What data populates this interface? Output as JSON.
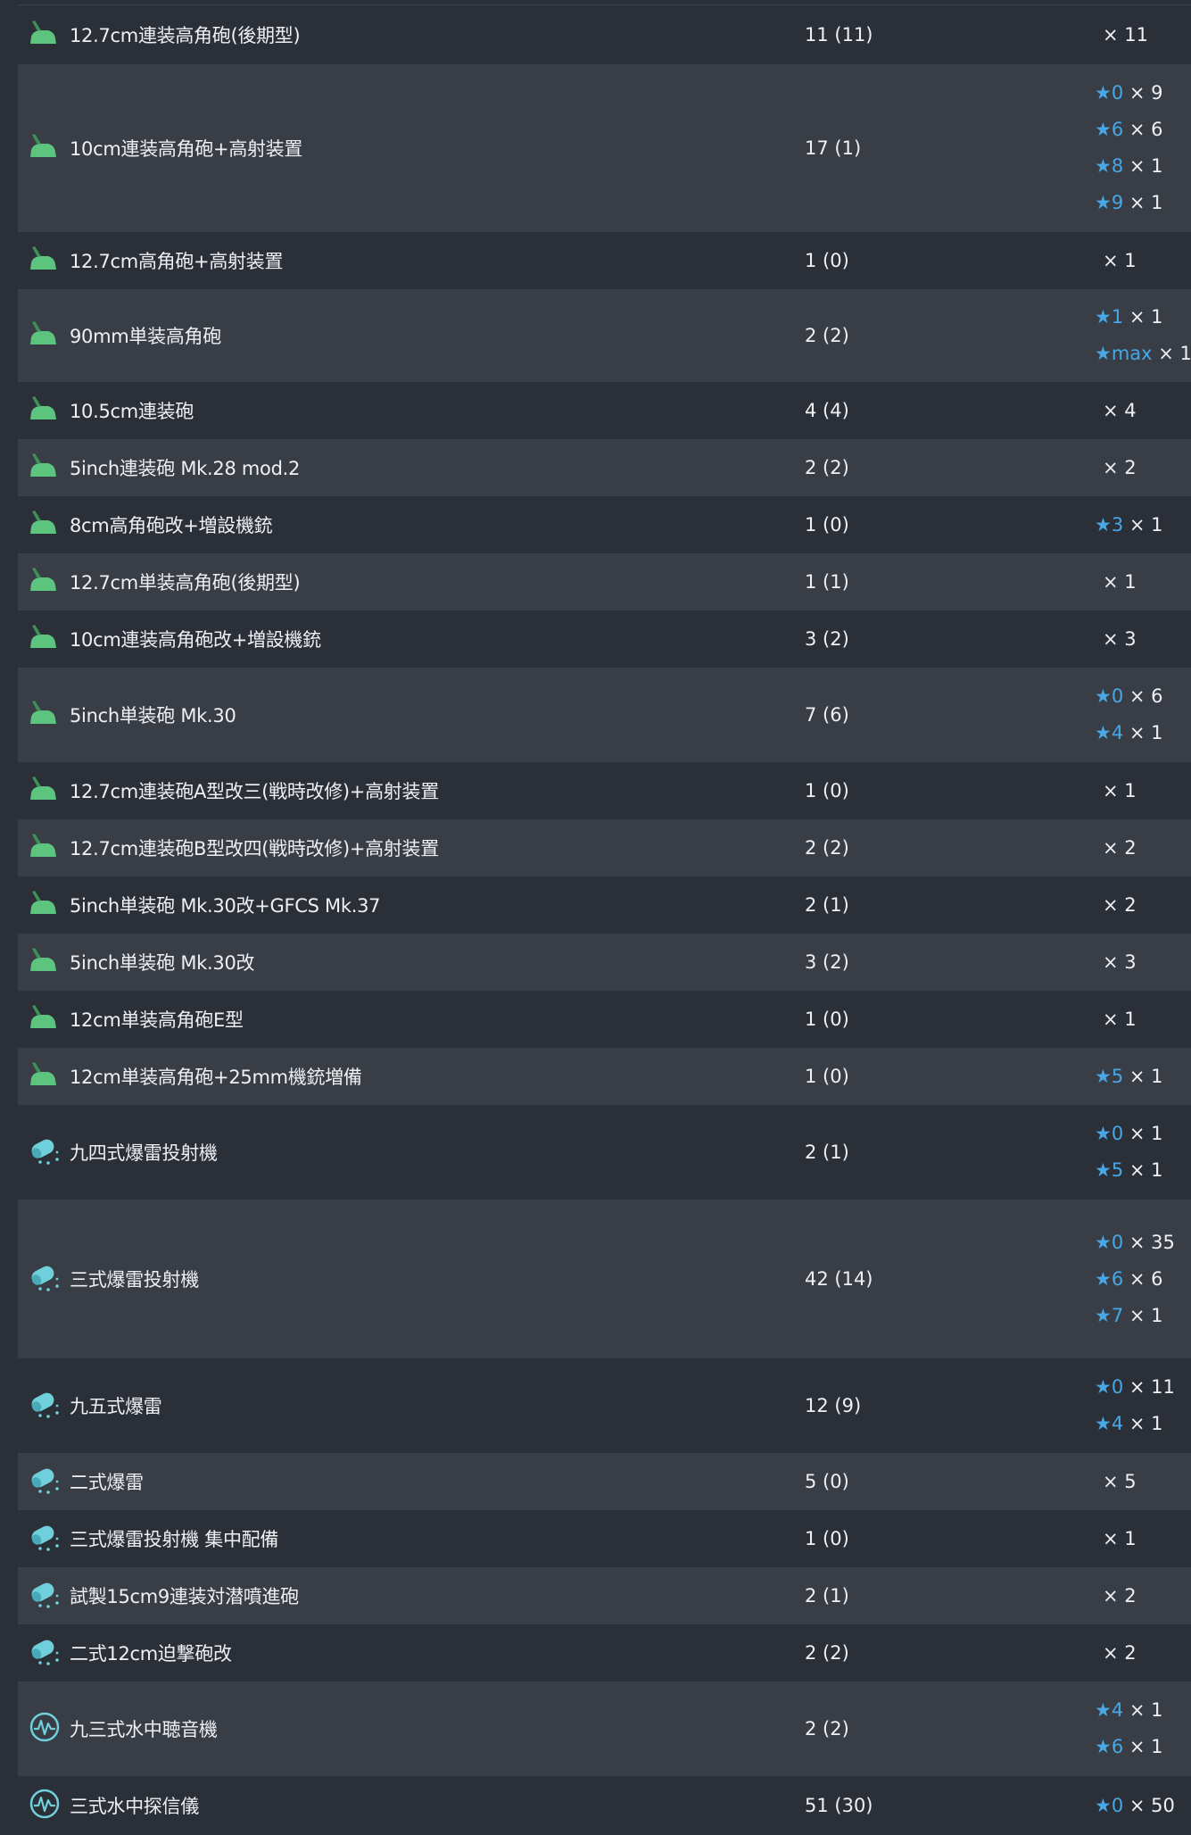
{
  "colors": {
    "background": "#2b2f38",
    "row_alt": "#393d46",
    "text": "#eef0f2",
    "star": "#46a8e6",
    "gun_icon": "#5cc47e",
    "asw_icon": "#6fd0dc"
  },
  "rows": [
    {
      "name": "12.7cm連装高角砲(後期型)",
      "icon": "aa-gun-icon",
      "count": "11 (11)",
      "stars": [
        {
          "level": null,
          "count": "× 11"
        }
      ]
    },
    {
      "name": "10cm連装高角砲+高射装置",
      "icon": "aa-gun-icon",
      "count": "17 (1)",
      "stars": [
        {
          "level": "0",
          "count": "× 9"
        },
        {
          "level": "6",
          "count": "× 6"
        },
        {
          "level": "8",
          "count": "× 1"
        },
        {
          "level": "9",
          "count": "× 1"
        }
      ]
    },
    {
      "name": "12.7cm高角砲+高射装置",
      "icon": "aa-gun-icon",
      "count": "1 (0)",
      "stars": [
        {
          "level": null,
          "count": "× 1"
        }
      ]
    },
    {
      "name": "90mm単装高角砲",
      "icon": "aa-gun-icon",
      "count": "2 (2)",
      "stars": [
        {
          "level": "1",
          "count": "× 1"
        },
        {
          "level": "max",
          "count": "× 1"
        }
      ]
    },
    {
      "name": "10.5cm連装砲",
      "icon": "aa-gun-icon",
      "count": "4 (4)",
      "stars": [
        {
          "level": null,
          "count": "× 4"
        }
      ]
    },
    {
      "name": "5inch連装砲 Mk.28 mod.2",
      "icon": "aa-gun-icon",
      "count": "2 (2)",
      "stars": [
        {
          "level": null,
          "count": "× 2"
        }
      ]
    },
    {
      "name": "8cm高角砲改+増設機銃",
      "icon": "aa-gun-icon",
      "count": "1 (0)",
      "stars": [
        {
          "level": "3",
          "count": "× 1"
        }
      ]
    },
    {
      "name": "12.7cm単装高角砲(後期型)",
      "icon": "aa-gun-icon",
      "count": "1 (1)",
      "stars": [
        {
          "level": null,
          "count": "× 1"
        }
      ]
    },
    {
      "name": "10cm連装高角砲改+増設機銃",
      "icon": "aa-gun-icon",
      "count": "3 (2)",
      "stars": [
        {
          "level": null,
          "count": "× 3"
        }
      ]
    },
    {
      "name": "5inch単装砲 Mk.30",
      "icon": "aa-gun-icon",
      "count": "7 (6)",
      "stars": [
        {
          "level": "0",
          "count": "× 6"
        },
        {
          "level": "4",
          "count": "× 1"
        }
      ]
    },
    {
      "name": "12.7cm連装砲A型改三(戦時改修)+高射装置",
      "icon": "aa-gun-icon",
      "count": "1 (0)",
      "stars": [
        {
          "level": null,
          "count": "× 1"
        }
      ]
    },
    {
      "name": "12.7cm連装砲B型改四(戦時改修)+高射装置",
      "icon": "aa-gun-icon",
      "count": "2 (2)",
      "stars": [
        {
          "level": null,
          "count": "× 2"
        }
      ]
    },
    {
      "name": "5inch単装砲 Mk.30改+GFCS Mk.37",
      "icon": "aa-gun-icon",
      "count": "2 (1)",
      "stars": [
        {
          "level": null,
          "count": "× 2"
        }
      ]
    },
    {
      "name": "5inch単装砲 Mk.30改",
      "icon": "aa-gun-icon",
      "count": "3 (2)",
      "stars": [
        {
          "level": null,
          "count": "× 3"
        }
      ]
    },
    {
      "name": "12cm単装高角砲E型",
      "icon": "aa-gun-icon",
      "count": "1 (0)",
      "stars": [
        {
          "level": null,
          "count": "× 1"
        }
      ]
    },
    {
      "name": "12cm単装高角砲+25mm機銃増備",
      "icon": "aa-gun-icon",
      "count": "1 (0)",
      "stars": [
        {
          "level": "5",
          "count": "× 1"
        }
      ]
    },
    {
      "name": "九四式爆雷投射機",
      "icon": "depth-charge-icon",
      "count": "2 (1)",
      "stars": [
        {
          "level": "0",
          "count": "× 1"
        },
        {
          "level": "5",
          "count": "× 1"
        }
      ]
    },
    {
      "name": "三式爆雷投射機",
      "icon": "depth-charge-icon",
      "count": "42 (14)",
      "stars": [
        {
          "level": "0",
          "count": "× 35"
        },
        {
          "level": "6",
          "count": "× 6"
        },
        {
          "level": "7",
          "count": "× 1"
        }
      ]
    },
    {
      "name": "九五式爆雷",
      "icon": "depth-charge-icon",
      "count": "12 (9)",
      "stars": [
        {
          "level": "0",
          "count": "× 11"
        },
        {
          "level": "4",
          "count": "× 1"
        }
      ]
    },
    {
      "name": "二式爆雷",
      "icon": "depth-charge-icon",
      "count": "5 (0)",
      "stars": [
        {
          "level": null,
          "count": "× 5"
        }
      ]
    },
    {
      "name": "三式爆雷投射機 集中配備",
      "icon": "depth-charge-icon",
      "count": "1 (0)",
      "stars": [
        {
          "level": null,
          "count": "× 1"
        }
      ]
    },
    {
      "name": "試製15cm9連装対潜噴進砲",
      "icon": "depth-charge-icon",
      "count": "2 (1)",
      "stars": [
        {
          "level": null,
          "count": "× 2"
        }
      ]
    },
    {
      "name": "二式12cm迫撃砲改",
      "icon": "depth-charge-icon",
      "count": "2 (2)",
      "stars": [
        {
          "level": null,
          "count": "× 2"
        }
      ]
    },
    {
      "name": "九三式水中聴音機",
      "icon": "sonar-icon",
      "count": "2 (2)",
      "stars": [
        {
          "level": "4",
          "count": "× 1"
        },
        {
          "level": "6",
          "count": "× 1"
        }
      ]
    },
    {
      "name": "三式水中探信儀",
      "icon": "sonar-icon",
      "count": "51 (30)",
      "stars": [
        {
          "level": "0",
          "count": "× 50"
        },
        {
          "level": null,
          "count": ""
        }
      ]
    }
  ]
}
